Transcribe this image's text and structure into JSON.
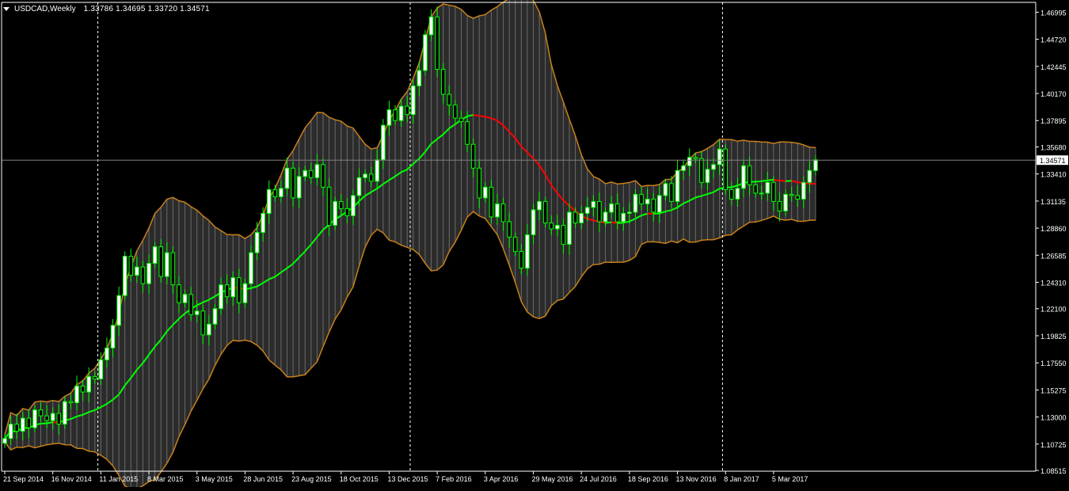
{
  "header": {
    "symbol": "USDCAD,Weekly",
    "ohlc": "1.33786 1.34695 1.33720 1.34571"
  },
  "colors": {
    "background": "#000000",
    "axis": "#ffffff",
    "grid": "#ffffff",
    "bull_candle": "#ffffff",
    "bear_candle": "#000000",
    "candle_outline": "#00ff00",
    "band": "#c8811a",
    "band_fill": "#2b2b2b",
    "ma_up": "#00ff00",
    "ma_down": "#ff0000",
    "price_line": "#808080"
  },
  "chart_data": {
    "type": "line",
    "symbol": "USDCAD",
    "timeframe": "Weekly",
    "last_price": "1.34571",
    "ylim": [
      1.0845,
      1.4782
    ],
    "y_ticks": [
      "1.46995",
      "1.44720",
      "1.42445",
      "1.40170",
      "1.37895",
      "1.35680",
      "1.33410",
      "1.31135",
      "1.28860",
      "1.26585",
      "1.24310",
      "1.22100",
      "1.19825",
      "1.17550",
      "1.15275",
      "1.13000",
      "1.10725",
      "1.08515"
    ],
    "x_tick_labels": [
      "21 Sep 2014",
      "16 Nov 2014",
      "11 Jan 2015",
      "8 Mar 2015",
      "3 May 2015",
      "28 Jun 2015",
      "23 Aug 2015",
      "18 Oct 2015",
      "13 Dec 2015",
      "7 Feb 2016",
      "3 Apr 2016",
      "29 May 2016",
      "24 Jul 2016",
      "18 Sep 2016",
      "13 Nov 2016",
      "8 Jan 2017",
      "5 Mar 2017"
    ],
    "x_tick_week_index": [
      0,
      8,
      16,
      24,
      32,
      40,
      48,
      56,
      64,
      72,
      80,
      88,
      96,
      104,
      112,
      120,
      128
    ],
    "period_separators_week_index": [
      15,
      67,
      119
    ],
    "close": [
      1.112,
      1.124,
      1.118,
      1.129,
      1.121,
      1.136,
      1.131,
      1.127,
      1.133,
      1.124,
      1.143,
      1.142,
      1.156,
      1.151,
      1.164,
      1.162,
      1.178,
      1.188,
      1.207,
      1.232,
      1.265,
      1.249,
      1.256,
      1.242,
      1.259,
      1.273,
      1.248,
      1.268,
      1.241,
      1.226,
      1.233,
      1.216,
      1.219,
      1.199,
      1.208,
      1.221,
      1.241,
      1.231,
      1.247,
      1.226,
      1.242,
      1.268,
      1.285,
      1.301,
      1.321,
      1.315,
      1.322,
      1.339,
      1.314,
      1.332,
      1.337,
      1.331,
      1.342,
      1.323,
      1.291,
      1.311,
      1.305,
      1.299,
      1.316,
      1.331,
      1.334,
      1.328,
      1.346,
      1.375,
      1.388,
      1.379,
      1.391,
      1.384,
      1.408,
      1.421,
      1.451,
      1.466,
      1.422,
      1.401,
      1.392,
      1.381,
      1.378,
      1.359,
      1.339,
      1.314,
      1.323,
      1.298,
      1.309,
      1.294,
      1.281,
      1.269,
      1.255,
      1.283,
      1.304,
      1.311,
      1.293,
      1.288,
      1.291,
      1.275,
      1.302,
      1.293,
      1.301,
      1.306,
      1.311,
      1.294,
      1.302,
      1.309,
      1.294,
      1.301,
      1.302,
      1.317,
      1.309,
      1.313,
      1.302,
      1.316,
      1.326,
      1.311,
      1.337,
      1.341,
      1.348,
      1.347,
      1.327,
      1.338,
      1.342,
      1.355,
      1.321,
      1.313,
      1.322,
      1.341,
      1.325,
      1.318,
      1.318,
      1.327,
      1.311,
      1.303,
      1.317,
      1.316,
      1.313,
      1.327,
      1.337,
      1.346
    ],
    "series": [
      {
        "name": "",
        "role": "moving_average",
        "color_up": "#00ff00",
        "color_down": "#ff0000"
      },
      {
        "name": "",
        "role": "bollinger_upper",
        "color": "#c8811a"
      },
      {
        "name": "",
        "role": "bollinger_lower",
        "color": "#c8811a"
      }
    ],
    "grid": false,
    "legend": "none"
  }
}
